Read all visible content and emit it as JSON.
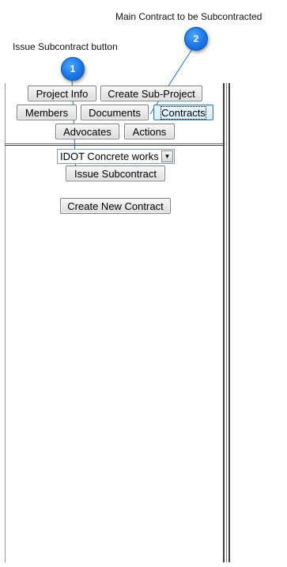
{
  "callouts": {
    "one": {
      "number": "1",
      "text": "Issue Subcontract button"
    },
    "two": {
      "number": "2",
      "text": "Main Contract to be Subcontracted"
    }
  },
  "tabs": {
    "project_info": "Project Info",
    "create_sub_project": "Create Sub-Project",
    "members": "Members",
    "documents": "Documents",
    "contracts": "Contracts",
    "advocates": "Advocates",
    "actions": "Actions",
    "active": "Contracts"
  },
  "contract_select": {
    "selected_value": "IDOT Concrete works",
    "arrow_icon": "triangle-down"
  },
  "buttons": {
    "issue_subcontract": "Issue Subcontract",
    "create_new_contract": "Create New Contract"
  },
  "colors": {
    "badge": "#1976e6",
    "callout_line": "#1e6fd9",
    "active_tab_border": "#3c7fb1"
  }
}
